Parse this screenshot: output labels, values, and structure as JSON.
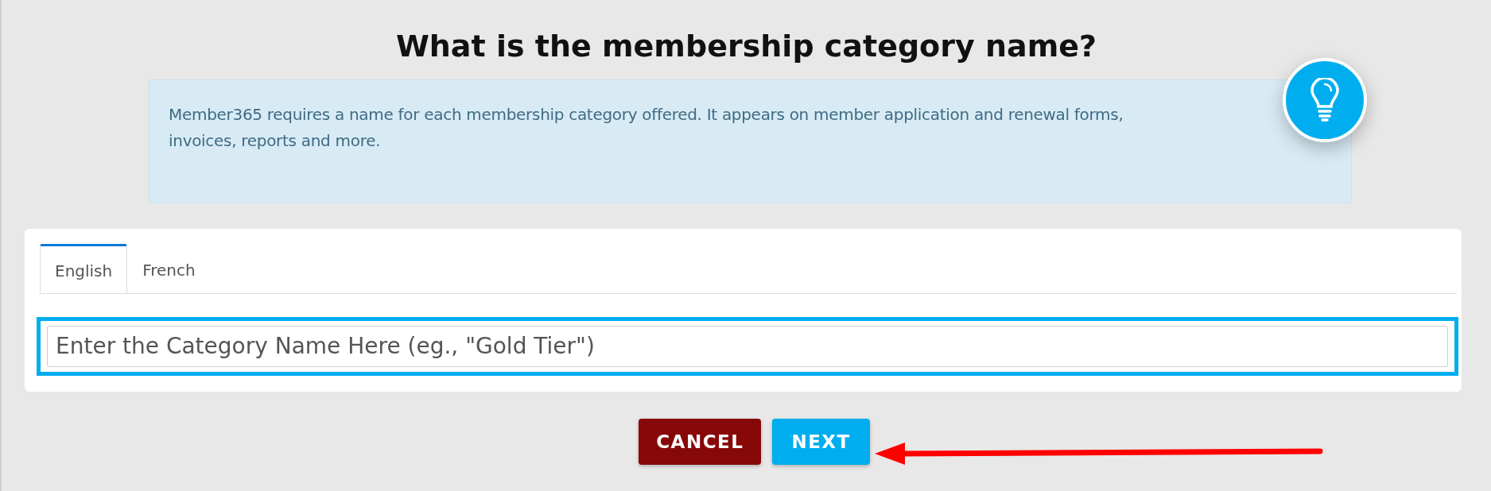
{
  "title": "What is the membership category name?",
  "info": {
    "text": "Member365 requires a name for each membership category offered. It appears on member application and renewal forms, invoices, reports and more."
  },
  "tabs": [
    {
      "label": "English",
      "selected": true
    },
    {
      "label": "French",
      "selected": false
    }
  ],
  "name_field": {
    "placeholder": "Enter the Category Name Here (eg., \"Gold Tier\")",
    "highlighted": true
  },
  "buttons": [
    {
      "label": "CANCEL",
      "kind": "cancel"
    },
    {
      "label": "NEXT",
      "kind": "next"
    }
  ]
}
